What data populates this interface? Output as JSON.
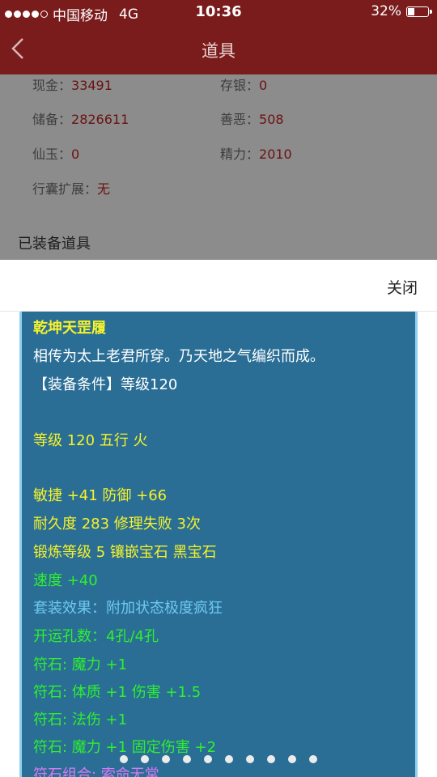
{
  "status": {
    "carrier": "中国移动",
    "network": "4G",
    "time": "10:36",
    "battery": "32%",
    "battery_level": 0.32
  },
  "nav": {
    "title": "道具",
    "back_icon": "chevron-left-icon"
  },
  "stats": [
    {
      "label": "现金：",
      "value": "33491"
    },
    {
      "label": "存银：",
      "value": "0"
    },
    {
      "label": "储备：",
      "value": "2826611"
    },
    {
      "label": "善恶：",
      "value": "508"
    },
    {
      "label": "仙玉：",
      "value": "0"
    },
    {
      "label": "精力：",
      "value": "2010"
    },
    {
      "label": "行囊扩展：",
      "value": "无"
    }
  ],
  "section_title": "已装备道具",
  "popup": {
    "close_label": "关闭",
    "item_name": "乾坤天罡履",
    "lines": [
      "相传为太上老君所穿。乃天地之气编织而成。",
      "【装备条件】等级120",
      "等级 120 五行 火",
      "敏捷 +41 防御 +66",
      "耐久度 283 修理失败 3次",
      "锻炼等级 5 镶嵌宝石 黑宝石",
      "速度 +40",
      "套装效果：附加状态极度疯狂",
      "开运孔数：4孔/4孔",
      "符石: 魔力 +1",
      "符石: 体质 +1 伤害 +1.5",
      "符石: 法伤 +1",
      "符石: 魔力 +1 固定伤害 +2",
      "符石组合: 索命无常"
    ]
  },
  "pager": {
    "count": 10,
    "active": 0
  },
  "colors": {
    "header": "#7a1c1c",
    "card_bg": "#2a6e95",
    "text_yellow": "#f6f22a",
    "text_green": "#2ef02e",
    "text_blue": "#6fc8f2",
    "text_purple": "#d97af2"
  }
}
